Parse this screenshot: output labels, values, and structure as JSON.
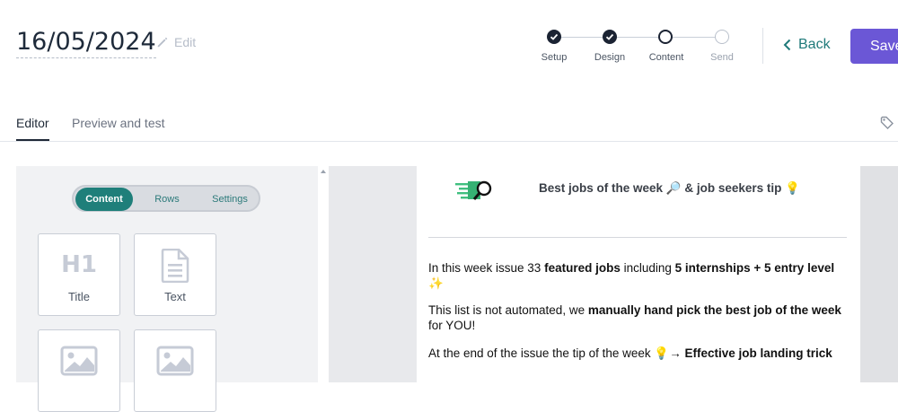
{
  "header": {
    "date": "16/05/2024",
    "edit_label": "Edit",
    "back_label": "Back",
    "save_label": "Save"
  },
  "stepper": {
    "steps": [
      {
        "label": "Setup",
        "state": "done"
      },
      {
        "label": "Design",
        "state": "done"
      },
      {
        "label": "Content",
        "state": "current"
      },
      {
        "label": "Send",
        "state": "todo"
      }
    ]
  },
  "tabs": [
    {
      "label": "Editor",
      "active": true
    },
    {
      "label": "Preview and test",
      "active": false
    }
  ],
  "left_panel": {
    "segments": [
      "Content",
      "Rows",
      "Settings"
    ],
    "active_segment": "Content",
    "blocks": [
      {
        "label": "Title",
        "icon": "h1-icon"
      },
      {
        "label": "Text",
        "icon": "document-text-icon"
      },
      {
        "label": "",
        "icon": "image-icon"
      },
      {
        "label": "",
        "icon": "image-icon"
      }
    ]
  },
  "email": {
    "title": "Best jobs of the week 🔎 & job seekers tip 💡",
    "p1": {
      "pre": "In this week issue 33 ",
      "b1": "featured jobs",
      "mid": " including ",
      "b2": "5 internships + 5 entry level",
      "line2": "✨"
    },
    "p2": {
      "pre": "This list is not automated, we ",
      "b1": "manually hand pick the best job of the week",
      "line2": "for YOU!"
    },
    "p3": {
      "pre": "At the end of the issue the tip of the week 💡→ ",
      "b1": "Effective job landing trick"
    }
  },
  "colors": {
    "accent_teal": "#1f7f7a",
    "save_purple": "#6b57d6",
    "stepper_dark": "#1b2333"
  }
}
